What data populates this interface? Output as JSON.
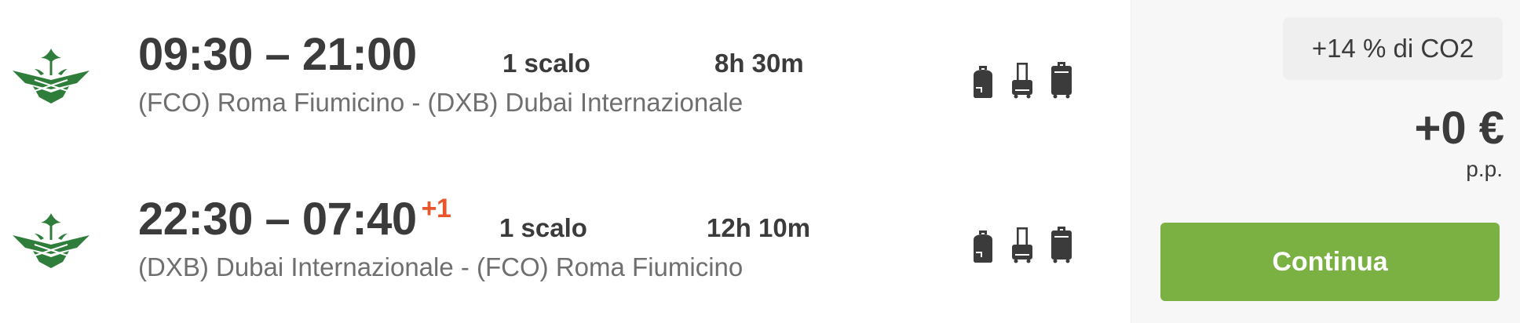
{
  "flights": [
    {
      "times": "09:30 – 21:00",
      "day_offset": "",
      "route": "(FCO) Roma Fiumicino - (DXB) Dubai Internazionale",
      "stops": "1 scalo",
      "duration": "8h 30m"
    },
    {
      "times": "22:30 – 07:40",
      "day_offset": "+1",
      "route": "(DXB) Dubai Internazionale - (FCO) Roma Fiumicino",
      "stops": "1 scalo",
      "duration": "12h 10m"
    }
  ],
  "icons": {
    "airline": "saudia-airline-logo",
    "baggage": [
      "backpack-icon",
      "trolley-icon",
      "suitcase-icon"
    ]
  },
  "summary": {
    "co2": "+14 % di CO2",
    "price": "+0 €",
    "per_person": "p.p.",
    "continue_label": "Continua"
  },
  "colors": {
    "accent_green": "#7bb142",
    "logo_green": "#2e7d3a",
    "day_offset": "#e8562a"
  }
}
